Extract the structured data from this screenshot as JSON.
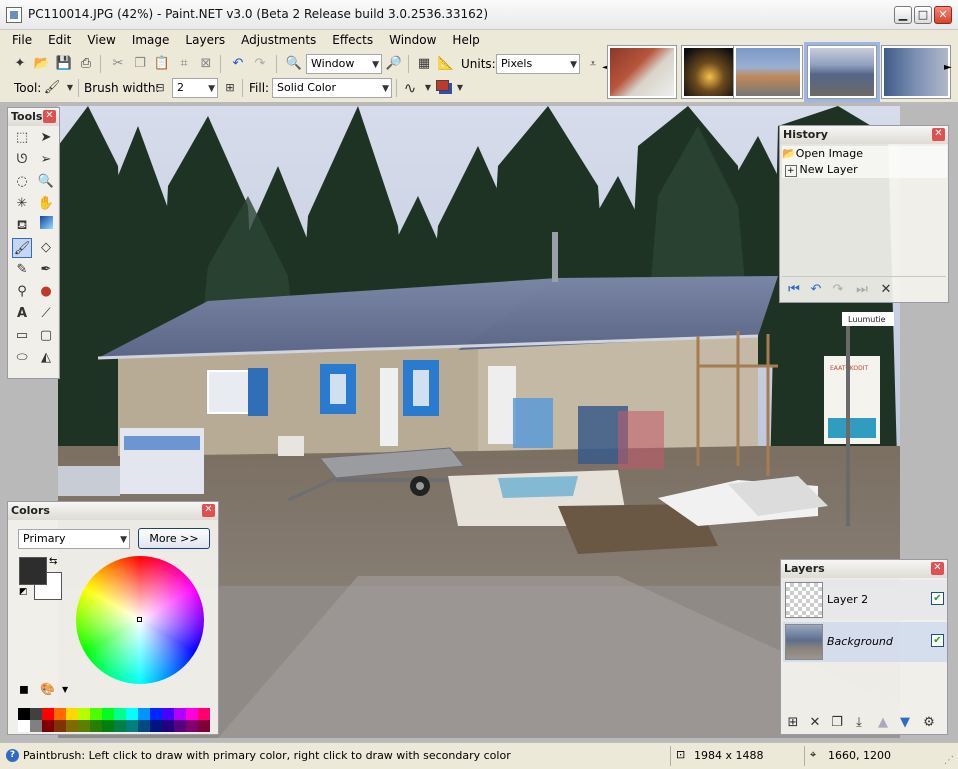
{
  "window": {
    "title": "PC110014.JPG (42%) - Paint.NET v3.0 (Beta 2 Release build 3.0.2536.33162)",
    "minimize": "▁",
    "maximize": "□",
    "close": "✕"
  },
  "menu": [
    "File",
    "Edit",
    "View",
    "Image",
    "Layers",
    "Adjustments",
    "Effects",
    "Window",
    "Help"
  ],
  "toolbar": {
    "zoom_value": "Window",
    "units_label": "Units:",
    "units_value": "Pixels",
    "tool_label": "Tool:",
    "brush_width_label": "Brush width:",
    "brush_width_value": "2",
    "fill_label": "Fill:",
    "fill_value": "Solid Color"
  },
  "thumbnails_nav": {
    "prev": "◄",
    "next": "►"
  },
  "tools_panel": {
    "title": "Tools",
    "close": "✕"
  },
  "history_panel": {
    "title": "History",
    "close": "✕",
    "items": [
      "Open Image",
      "New Layer"
    ]
  },
  "colors_panel": {
    "title": "Colors",
    "close": "✕",
    "mode_value": "Primary",
    "more_button": "More >>",
    "primary_color": "#2d2d2d",
    "secondary_color": "#ffffff"
  },
  "layers_panel": {
    "title": "Layers",
    "close": "✕",
    "layers": [
      {
        "name": "Layer 2",
        "visible": true
      },
      {
        "name": "Background",
        "visible": true
      }
    ]
  },
  "photo": {
    "sign_text": "Luumutie",
    "billboard_text": "EAATUKODIT"
  },
  "status": {
    "message": "Paintbrush: Left click to draw with primary color, right click to draw with secondary color",
    "image_size": "1984 x 1488",
    "cursor_position": "1660, 1200"
  },
  "palette": [
    "#000000",
    "#404040",
    "#ff0000",
    "#ff6a00",
    "#ffd800",
    "#b6ff00",
    "#4cff00",
    "#00ff21",
    "#00ff90",
    "#00ffff",
    "#0094ff",
    "#0026ff",
    "#4800ff",
    "#b200ff",
    "#ff00dc",
    "#ff006e",
    "#ffffff",
    "#808080",
    "#7f0000",
    "#7f3300",
    "#7f6a00",
    "#5b7f00",
    "#267f00",
    "#007f0e",
    "#007f46",
    "#007f7f",
    "#004a7f",
    "#00137f",
    "#21007f",
    "#57007f",
    "#7f006e",
    "#7f0037"
  ],
  "colors": {
    "accent": "#316ac5",
    "panel_bg": "#f4f3ee",
    "close_red": "#e15050"
  }
}
